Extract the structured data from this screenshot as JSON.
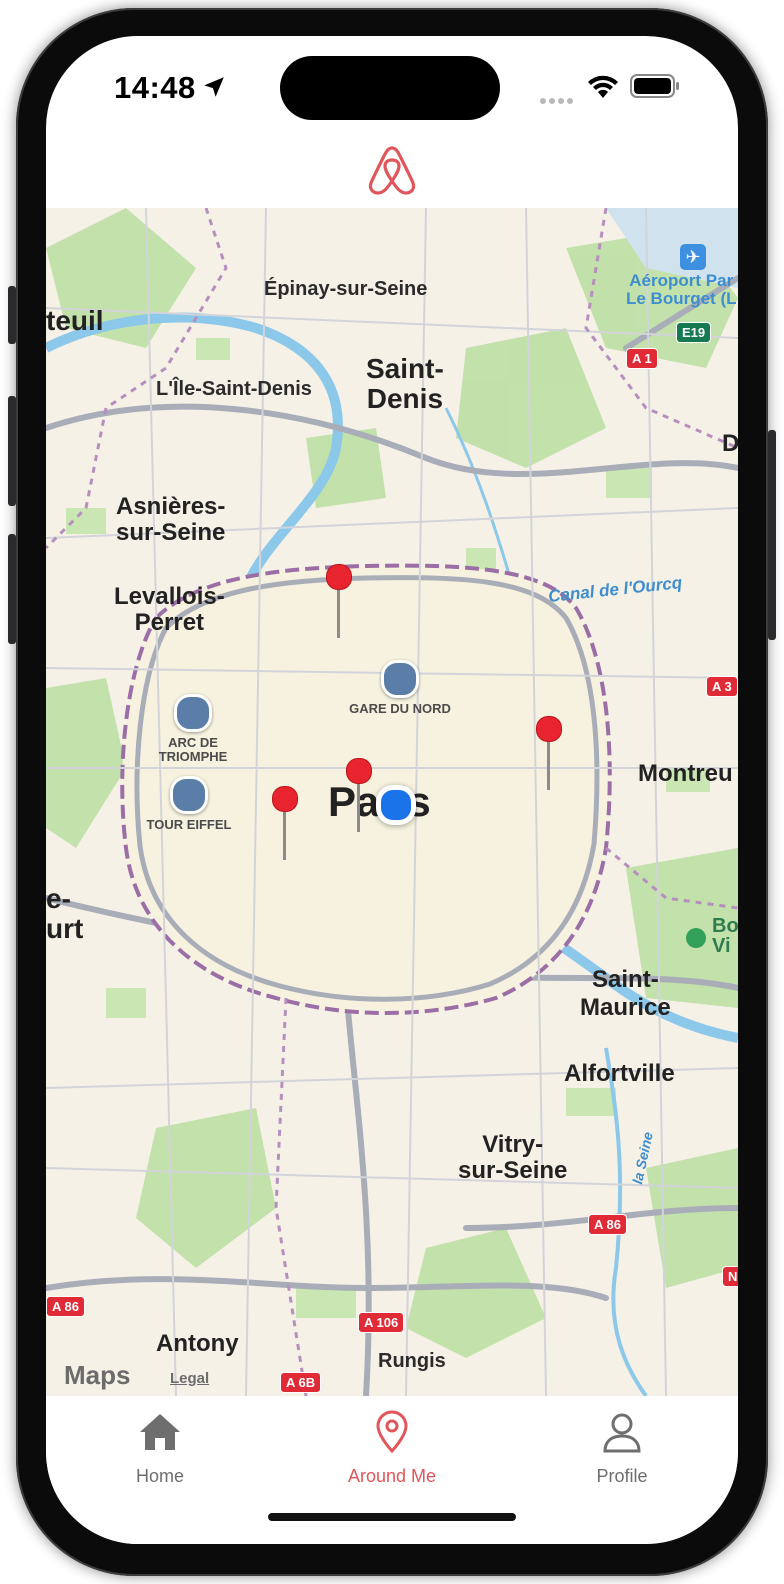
{
  "status_bar": {
    "time": "14:48"
  },
  "brand": {
    "accent": "#e0565b",
    "logo_icon": "airbnb-logo-icon"
  },
  "map": {
    "labels": [
      "Épinay-sur-Seine",
      "Saint-\nDenis",
      "L'Île-Saint-Denis",
      "teuil",
      "Asnières-\nsur-Seine",
      "Levallois-\nPerret",
      "Canal de l'Ourcq",
      "Montreu",
      "Paris",
      "e-\nurt",
      "Saint-\nMaurice",
      "Alfortville",
      "Vitry-\nsur-Seine",
      "Antony",
      "Rungis",
      "Aéroport Par\nLe Bourget (L",
      "D",
      "Bo\nVi",
      "la Seine"
    ],
    "poi": [
      {
        "name": "GARE DU NORD",
        "icon": "train-station-icon"
      },
      {
        "name": "ARC DE\nTRIOMPHE",
        "icon": "landmark-icon"
      },
      {
        "name": "TOUR EIFFEL",
        "icon": "landmark-icon"
      }
    ],
    "road_badges": [
      "A 1",
      "E19",
      "A 3",
      "A 86",
      "A 86",
      "A 106",
      "A 6B",
      "N"
    ],
    "pins_count": 4,
    "attribution": "Maps",
    "legal": "Legal"
  },
  "tabs": [
    {
      "label": "Home",
      "icon": "home-icon",
      "active": false
    },
    {
      "label": "Around Me",
      "icon": "location-pin-icon",
      "active": true
    },
    {
      "label": "Profile",
      "icon": "profile-icon",
      "active": false
    }
  ]
}
